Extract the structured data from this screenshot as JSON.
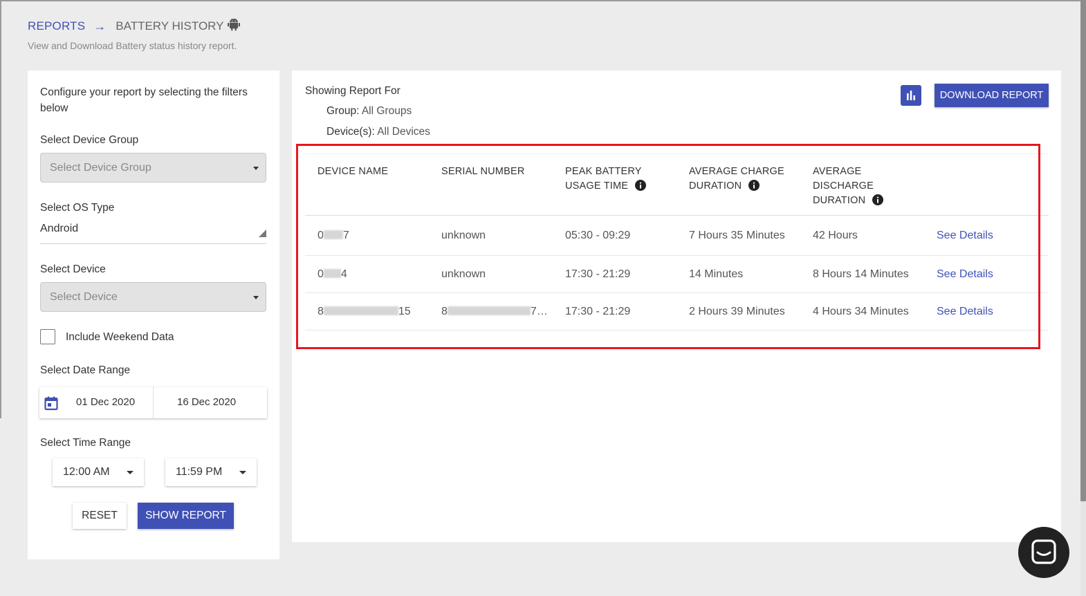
{
  "breadcrumb": {
    "root": "REPORTS",
    "arrow": "→",
    "current": "BATTERY HISTORY",
    "current_icon": "android-icon"
  },
  "subtitle": "View and Download Battery status history report.",
  "filters": {
    "intro": "Configure your report by selecting the filters below",
    "device_group": {
      "label": "Select Device Group",
      "placeholder": "Select Device Group"
    },
    "os_type": {
      "label": "Select OS Type",
      "value": "Android"
    },
    "device": {
      "label": "Select Device",
      "placeholder": "Select Device"
    },
    "weekend": {
      "label": "Include Weekend Data",
      "checked": false
    },
    "date_range": {
      "label": "Select Date Range",
      "start": "01 Dec 2020",
      "end": "16 Dec 2020",
      "icon": "calendar-icon"
    },
    "time_range": {
      "label": "Select Time Range",
      "start": "12:00 AM",
      "end": "11:59 PM"
    },
    "reset_label": "RESET",
    "show_label": "SHOW REPORT"
  },
  "report": {
    "showing_for": "Showing Report For",
    "group_label": "Group:",
    "group_value": "All Groups",
    "devices_label": "Device(s):",
    "devices_value": "All Devices",
    "chart_icon": "bar-chart-icon",
    "download_label": "DOWNLOAD REPORT",
    "columns": {
      "device_name": "DEVICE NAME",
      "serial_number": "SERIAL NUMBER",
      "peak_l1": "PEAK BATTERY",
      "peak_l2": "USAGE TIME",
      "avg_charge_l1": "AVERAGE CHARGE",
      "avg_charge_l2": "DURATION",
      "avg_discharge_l1": "AVERAGE",
      "avg_discharge_l2": "DISCHARGE",
      "avg_discharge_l3": "DURATION"
    },
    "rows": [
      {
        "name_start": "0",
        "name_end": "7",
        "serial": "unknown",
        "peak": "05:30 - 09:29",
        "charge": "7 Hours 35 Minutes",
        "discharge": "42 Hours",
        "action": "See Details"
      },
      {
        "name_start": "0",
        "name_end": "4",
        "serial": "unknown",
        "peak": "17:30 - 21:29",
        "charge": "14 Minutes",
        "discharge": "8 Hours 14 Minutes",
        "action": "See Details"
      },
      {
        "name_start": "8",
        "name_end": "15",
        "serial_start": "8",
        "serial_end": "7…",
        "peak": "17:30 - 21:29",
        "charge": "2 Hours 39 Minutes",
        "discharge": "4 Hours 34 Minutes",
        "action": "See Details"
      }
    ]
  },
  "colors": {
    "primary": "#3f51b5",
    "highlight": "#e8161f",
    "background": "#ececec"
  }
}
